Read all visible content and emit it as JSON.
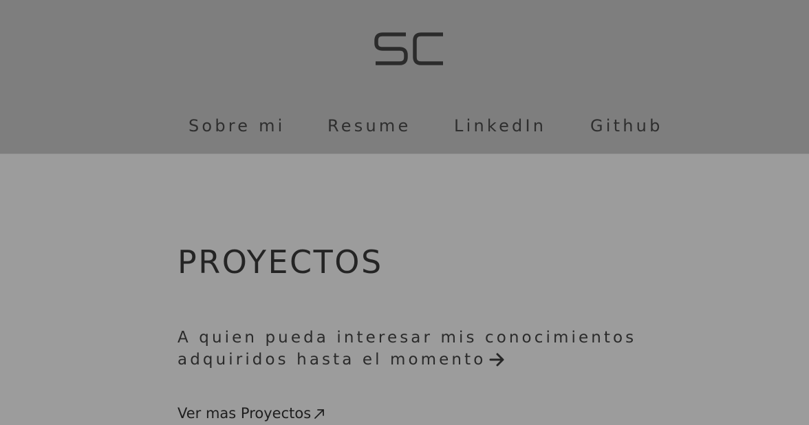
{
  "header": {
    "logo_text": "SC",
    "nav": [
      {
        "label": "Sobre mi"
      },
      {
        "label": "Resume"
      },
      {
        "label": "LinkedIn"
      },
      {
        "label": "Github"
      }
    ]
  },
  "main": {
    "title": "PROYECTOS",
    "intro_line1": "A quien pueda interesar mis conocimientos",
    "intro_line2": "adquiridos hasta el momento",
    "more_link": "Ver mas Proyectos",
    "arrow_icon": "arrow-right-icon",
    "external_icon": "arrow-up-right-icon"
  },
  "colors": {
    "header_bg": "#7e7e7e",
    "page_bg": "#9c9c9c",
    "text": "#262626"
  }
}
